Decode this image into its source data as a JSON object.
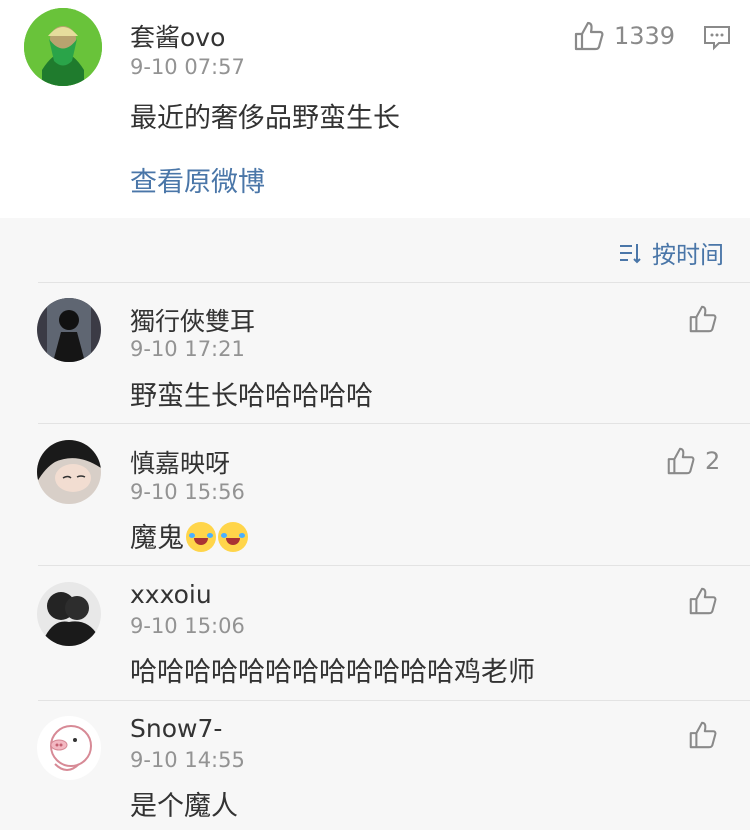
{
  "main_comment": {
    "username": "套酱ovo",
    "time": "9-10 07:57",
    "text": "最近的奢侈品野蛮生长",
    "like_count": "1339",
    "view_original": "查看原微博"
  },
  "sort_label": "按时间",
  "replies": [
    {
      "username": "獨行俠雙耳",
      "time": "9-10 17:21",
      "text": "野蛮生长哈哈哈哈哈",
      "like_count": ""
    },
    {
      "username": "慎嘉映呀",
      "time": "9-10 15:56",
      "text": "魔鬼",
      "like_count": "2",
      "emojis": [
        "laughing-tears",
        "laughing-tears"
      ]
    },
    {
      "username": "xxxoiu",
      "time": "9-10 15:06",
      "text": "哈哈哈哈哈哈哈哈哈哈哈哈鸡老师",
      "like_count": ""
    },
    {
      "username": "Snow7-",
      "time": "9-10 14:55",
      "text": "是个魔人",
      "like_count": ""
    }
  ]
}
